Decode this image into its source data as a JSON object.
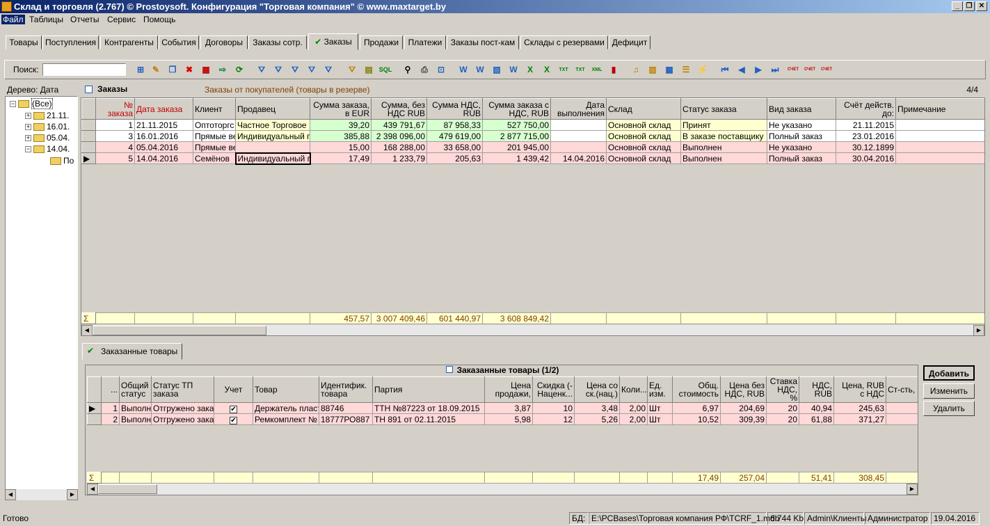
{
  "window": {
    "title": "Склад и торговля (2.767) © Prostoysoft. Конфигурация \"Торговая компания\" © www.maxtarget.by"
  },
  "menu": [
    "Файл",
    "Таблицы",
    "Отчеты",
    "Сервис",
    "Помощь"
  ],
  "tabs": [
    "Товары",
    "Поступления",
    "Контрагенты",
    "События",
    "Договоры",
    "Заказы сотр.",
    "Заказы",
    "Продажи",
    "Платежи",
    "Заказы пост-кам",
    "Склады с резервами",
    "Дефицит"
  ],
  "toolbar": {
    "search_label": "Поиск:",
    "search_value": ""
  },
  "tree": {
    "title": "Дерево: Дата",
    "nodes": [
      "(Все)",
      "21.11.",
      "16.01.",
      "05.04.",
      "14.04.",
      "По"
    ]
  },
  "orders": {
    "title": "Заказы",
    "subtitle": "Заказы от покупателей (товары в резерве)",
    "count": "4/4",
    "columns": [
      "№ заказа",
      "Дата заказа",
      "Клиент",
      "Продавец",
      "Сумма заказа, в EUR",
      "Сумма, без НДС RUB",
      "Сумма НДС, RUB",
      "Сумма заказа с НДС, RUB",
      "Дата выполнения",
      "Склад",
      "Статус заказа",
      "Вид заказа",
      "Счёт действ. до:",
      "Примечание"
    ],
    "rows": [
      [
        "1",
        "21.11.2015",
        "Оптоторгс",
        "Частное Торговое",
        "39,20",
        "439 791,67",
        "87 958,33",
        "527 750,00",
        "",
        "Основной склад",
        "Принят",
        "Не указано",
        "21.11.2015",
        ""
      ],
      [
        "3",
        "16.01.2016",
        "Прямые ве",
        "Индивидуальный пр",
        "385,88",
        "2 398 096,00",
        "479 619,00",
        "2 877 715,00",
        "",
        "Основной склад",
        "В заказе поставщику",
        "Полный заказ",
        "23.01.2016",
        ""
      ],
      [
        "4",
        "05.04.2016",
        "Прямые ве",
        "",
        "15,00",
        "168 288,00",
        "33 658,00",
        "201 945,00",
        "",
        "Основной склад",
        "Выполнен",
        "Не указано",
        "30.12.1899",
        ""
      ],
      [
        "5",
        "14.04.2016",
        "Семёнов",
        "Индивидуальный пр",
        "17,49",
        "1 233,79",
        "205,63",
        "1 439,42",
        "14.04.2016",
        "Основной склад",
        "Выполнен",
        "Полный заказ",
        "30.04.2016",
        ""
      ]
    ],
    "sum_symbol": "Σ",
    "totals": [
      "",
      "",
      "",
      "",
      "457,57",
      "3 007 409,46",
      "601 440,97",
      "3 608 849,42",
      "",
      "",
      "",
      "",
      "",
      ""
    ]
  },
  "detail": {
    "tab": "Заказанные товары",
    "title": "Заказанные товары (1/2)",
    "columns": [
      "...",
      "Общий статус",
      "Статус ТП заказа",
      "Учет",
      "Товар",
      "Идентифик. товара",
      "Партия",
      "Цена продажи,",
      "Скидка (-Наценк...",
      "Цена со ск.(нац.)",
      "Коли...",
      "Ед. изм.",
      "Общ. стоимость",
      "Цена без НДС, RUB",
      "Ставка НДС, %",
      "НДС, RUB",
      "Цена, RUB с НДС",
      "Ст-сть,"
    ],
    "rows": [
      [
        "1",
        "Выполн",
        "Отгружено зака",
        "✔",
        "Держатель пласт",
        "88746",
        "ТТН №87223 от 18.09.2015",
        "3,87",
        "10",
        "3,48",
        "2,00",
        "Шт",
        "6,97",
        "204,69",
        "20",
        "40,94",
        "245,63",
        ""
      ],
      [
        "2",
        "Выполн",
        "Отгружено зака",
        "✔",
        "Ремкомплект №",
        "18777РО887",
        "ТН 891 от 02.11.2015",
        "5,98",
        "12",
        "5,26",
        "2,00",
        "Шт",
        "10,52",
        "309,39",
        "20",
        "61,88",
        "371,27",
        ""
      ]
    ],
    "sum_symbol": "Σ",
    "totals": [
      "",
      "",
      "",
      "",
      "",
      "",
      "",
      "",
      "",
      "",
      "",
      "",
      "17,49",
      "257,04",
      "",
      "51,41",
      "308,45",
      ""
    ]
  },
  "buttons": {
    "add": "Добавить",
    "edit": "Изменить",
    "delete": "Удалить"
  },
  "status": {
    "ready": "Готово",
    "db_label": "БД:",
    "db_path": "E:\\PCBases\\Торговая компания РФ\\TCRF_1.mdb",
    "size": "6 744 Kb",
    "section": "Admin\\Клиенты",
    "user": "Администратор",
    "date": "19.04.2016"
  }
}
